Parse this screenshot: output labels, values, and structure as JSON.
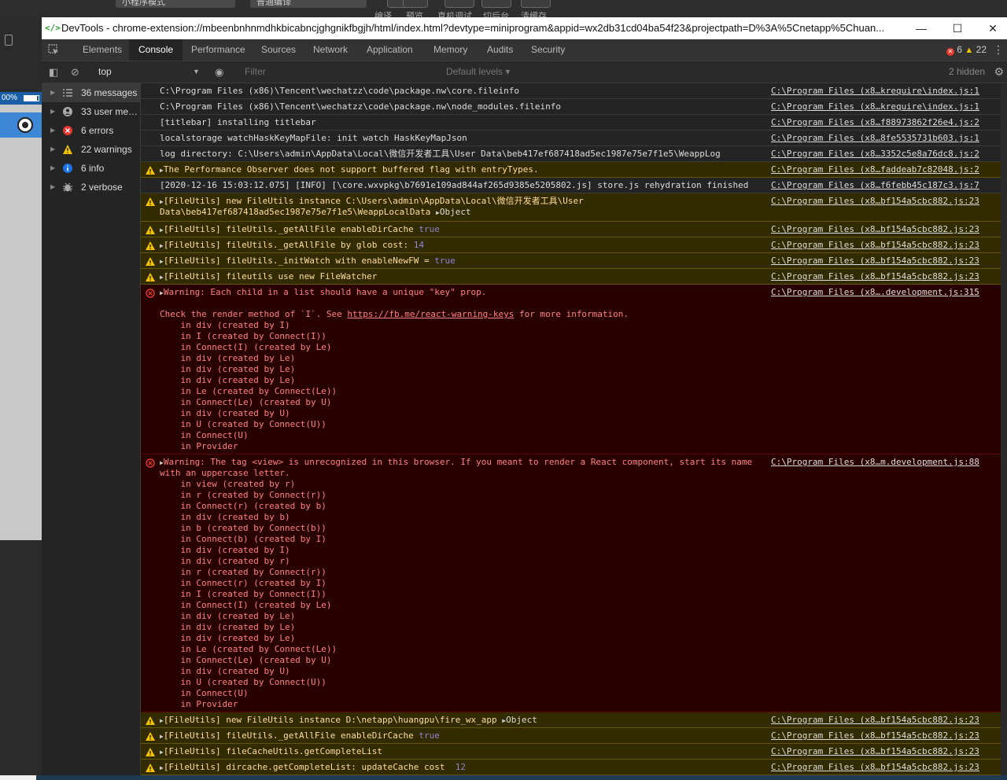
{
  "background_app": {
    "top_labels": [
      "小程序模式",
      "普通编译",
      "编译",
      "预览",
      "真机调试",
      "切后台",
      "清缓存"
    ],
    "zoom_label": "00%"
  },
  "window": {
    "title": "DevTools - chrome-extension://mbeenbnhnmdhkbicabncjghgnikfbgjh/html/index.html?devtype=miniprogram&appid=wx2db31cd04ba54f23&projectpath=D%3A%5Cnetapp%5Chuan...",
    "minimize": "—",
    "maximize": "☐",
    "close": "✕"
  },
  "tabs": [
    {
      "label": "Elements"
    },
    {
      "label": "Console"
    },
    {
      "label": "Performance"
    },
    {
      "label": "Sources"
    },
    {
      "label": "Network"
    },
    {
      "label": "Application"
    },
    {
      "label": "Memory"
    },
    {
      "label": "Audits"
    },
    {
      "label": "Security"
    }
  ],
  "counts": {
    "errors": "6",
    "warnings": "22"
  },
  "toolbar": {
    "context": "top",
    "filter_placeholder": "Filter",
    "levels": "Default levels ▾",
    "hidden": "2 hidden"
  },
  "sidebar": [
    {
      "label": "36 messages",
      "icon": "list-icon"
    },
    {
      "label": "33 user mes...",
      "icon": "user-icon"
    },
    {
      "label": "6 errors",
      "icon": "error-icon"
    },
    {
      "label": "22 warnings",
      "icon": "warning-icon"
    },
    {
      "label": "6 info",
      "icon": "info-icon"
    },
    {
      "label": "2 verbose",
      "icon": "bug-icon"
    }
  ],
  "messages": {
    "m1": {
      "text": "C:\\Program Files (x86)\\Tencent\\wechatzz\\code\\package.nw\\core.fileinfo",
      "src": "C:\\Program Files (x8…krequire\\index.js:1"
    },
    "m2": {
      "text": "C:\\Program Files (x86)\\Tencent\\wechatzz\\code\\package.nw\\node_modules.fileinfo",
      "src": "C:\\Program Files (x8…krequire\\index.js:1"
    },
    "m3": {
      "text": "[titlebar] installing titlebar",
      "src": "C:\\Program Files (x8…f88973862f26e4.js:2"
    },
    "m4": {
      "text": "localstorage watchHaskKeyMapFile: init watch HaskKeyMapJson",
      "src": "C:\\Program Files (x8…8fe5535731b603.js:1"
    },
    "m5": {
      "text": "log directory: C:\\Users\\admin\\AppData\\Local\\微信开发者工具\\User Data\\beb417ef687418ad5ec1987e75e7f1e5\\WeappLog",
      "src": "C:\\Program Files (x8…3352c5e8a76dc8.js:2"
    },
    "m6": {
      "text": "The Performance Observer does not support buffered flag with entryTypes.",
      "src": "C:\\Program Files (x8…faddeab7c82048.js:2"
    },
    "m7": {
      "text": "[2020-12-16 15:03:12.075] [INFO] [\\core.wxvpkg\\b7691e109ad844af265d9385e5205802.js] store.js rehydration finished",
      "src": "C:\\Program Files (x8…f6febb45c187c3.js:7"
    },
    "m8": {
      "line1": "[FileUtils] new FileUtils instance C:\\Users\\admin\\AppData\\Local\\微信开发者工具\\User",
      "line2": "Data\\beb417ef687418ad5ec1987e75e7f1e5\\WeappLocalData",
      "obj": "Object",
      "src": "C:\\Program Files (x8…bf154a5cbc882.js:23"
    },
    "m9": {
      "text": "[FileUtils] fileUtils._getAllFile enableDirCache",
      "val": "true",
      "src": "C:\\Program Files (x8…bf154a5cbc882.js:23"
    },
    "m10": {
      "text": "[FileUtils] fileUtils._getAllFile by glob cost:",
      "val": "14",
      "src": "C:\\Program Files (x8…bf154a5cbc882.js:23"
    },
    "m11": {
      "text": "[FileUtils] fileUtils._initWatch with enableNewFW =",
      "val": "true",
      "src": "C:\\Program Files (x8…bf154a5cbc882.js:23"
    },
    "m12": {
      "text": "[FileUtils] fileutils use new FileWatcher",
      "src": "C:\\Program Files (x8…bf154a5cbc882.js:23"
    },
    "m13": {
      "text": "Warning: Each child in a list should have a unique \"key\" prop.",
      "check_pre": "Check the render method of `I`. See ",
      "link": "https://fb.me/react-warning-keys",
      "check_post": " for more information.",
      "stack": "    in div (created by I)\n    in I (created by Connect(I))\n    in Connect(I) (created by Le)\n    in div (created by Le)\n    in div (created by Le)\n    in div (created by Le)\n    in Le (created by Connect(Le))\n    in Connect(Le) (created by U)\n    in div (created by U)\n    in U (created by Connect(U))\n    in Connect(U)\n    in Provider",
      "src": "C:\\Program Files (x8….development.js:315"
    },
    "m14": {
      "line1": "Warning: The tag <view> is unrecognized in this browser. If you meant to render a React component, start its name",
      "line2": "with an uppercase letter.",
      "stack": "    in view (created by r)\n    in r (created by Connect(r))\n    in Connect(r) (created by b)\n    in div (created by b)\n    in b (created by Connect(b))\n    in Connect(b) (created by I)\n    in div (created by I)\n    in div (created by r)\n    in r (created by Connect(r))\n    in Connect(r) (created by I)\n    in I (created by Connect(I))\n    in Connect(I) (created by Le)\n    in div (created by Le)\n    in div (created by Le)\n    in div (created by Le)\n    in Le (created by Connect(Le))\n    in Connect(Le) (created by U)\n    in div (created by U)\n    in U (created by Connect(U))\n    in Connect(U)\n    in Provider",
      "src": "C:\\Program Files (x8…m.development.js:88"
    },
    "m15": {
      "text": "[FileUtils] new FileUtils instance D:\\netapp\\huangpu\\fire_wx_app",
      "obj": "Object",
      "src": "C:\\Program Files (x8…bf154a5cbc882.js:23"
    },
    "m16": {
      "text": "[FileUtils] fileUtils._getAllFile enableDirCache",
      "val": "true",
      "src": "C:\\Program Files (x8…bf154a5cbc882.js:23"
    },
    "m17": {
      "text": "[FileUtils] fileCacheUtils.getCompleteList",
      "src": "C:\\Program Files (x8…bf154a5cbc882.js:23"
    },
    "m18": {
      "text": "[FileUtils] dircache.getCompleteList: updateCache cost ",
      "val": "12",
      "src": "C:\\Program Files (x8…bf154a5cbc882.js:23"
    }
  },
  "colors": {
    "error": "#e8372c",
    "warning": "#f5c400",
    "info": "#1a73e8"
  }
}
